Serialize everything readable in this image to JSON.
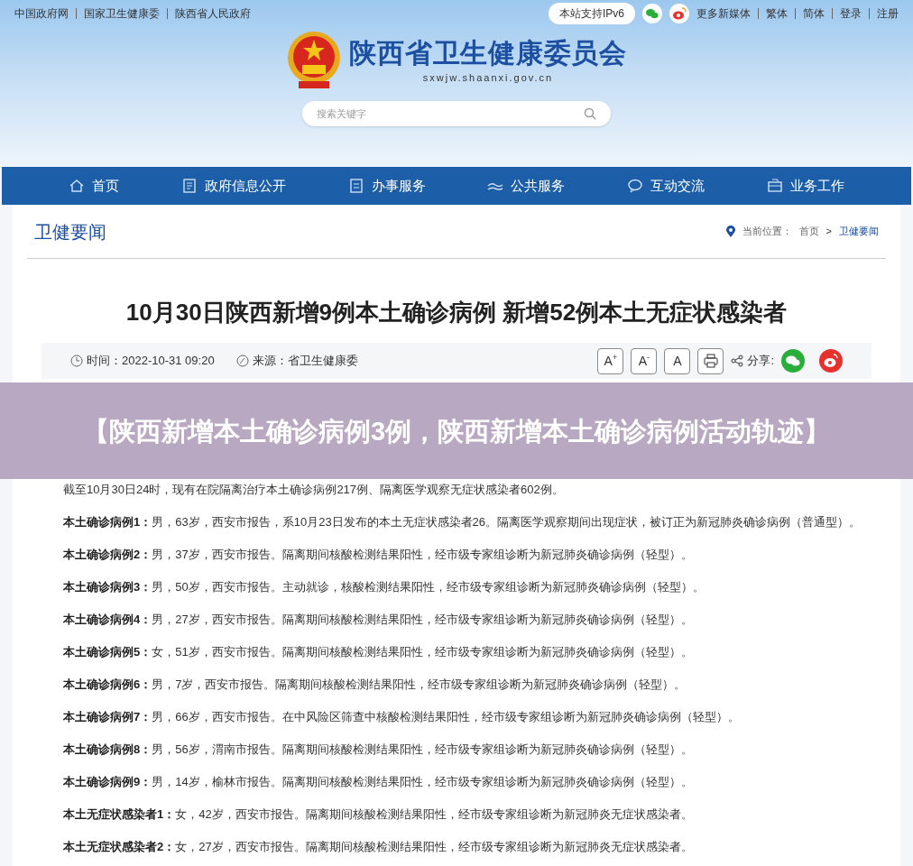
{
  "top_links": [
    "中国政府网",
    "国家卫生健康委",
    "陕西省人民政府"
  ],
  "top_right": {
    "ipv6": "本站支持IPv6",
    "media": "更多新媒体",
    "links": [
      "繁体",
      "简体",
      "登录",
      "注册"
    ]
  },
  "site": {
    "title": "陕西省卫生健康委员会",
    "domain": "sxwjw.shaanxi.gov.cn"
  },
  "search": {
    "placeholder": "搜索关键字"
  },
  "nav": [
    {
      "label": "首页",
      "kind": "home"
    },
    {
      "label": "政府信息公开",
      "kind": "doc"
    },
    {
      "label": "办事服务",
      "kind": "list"
    },
    {
      "label": "公共服务",
      "kind": "hands"
    },
    {
      "label": "互动交流",
      "kind": "chat"
    },
    {
      "label": "业务工作",
      "kind": "work"
    }
  ],
  "section": {
    "title": "卫健要闻",
    "location_label": "当前位置：",
    "breadcrumb": [
      "首页",
      "卫健要闻"
    ],
    "separator": ">"
  },
  "article": {
    "title": "10月30日陕西新增9例本土确诊病例 新增52例本土无症状感染者",
    "time": "时间：2022-10-31 09:20",
    "source": "来源：省卫生健康委",
    "font_buttons": [
      {
        "label": "A",
        "sup": "+"
      },
      {
        "label": "A",
        "sup": "-"
      },
      {
        "label": "A"
      }
    ],
    "share_label": "分享:"
  },
  "banner": "【陕西新增本土确诊病例3例，陕西新增本土确诊病例活动轨迹】",
  "paragraphs": [
    {
      "text": "截至10月30日24时，现有在院隔离治疗本土确诊病例217例、隔离医学观察无症状感染者602例。"
    },
    {
      "lead": "本土确诊病例1：",
      "text": "男，63岁，西安市报告，系10月23日发布的本土无症状感染者26。隔离医学观察期间出现症状，被订正为新冠肺炎确诊病例（普通型）。"
    },
    {
      "lead": "本土确诊病例2：",
      "text": "男，37岁，西安市报告。隔离期间核酸检测结果阳性，经市级专家组诊断为新冠肺炎确诊病例（轻型）。"
    },
    {
      "lead": "本土确诊病例3：",
      "text": "男，50岁，西安市报告。主动就诊，核酸检测结果阳性，经市级专家组诊断为新冠肺炎确诊病例（轻型）。"
    },
    {
      "lead": "本土确诊病例4：",
      "text": "男，27岁，西安市报告。隔离期间核酸检测结果阳性，经市级专家组诊断为新冠肺炎确诊病例（轻型）。"
    },
    {
      "lead": "本土确诊病例5：",
      "text": "女，51岁，西安市报告。隔离期间核酸检测结果阳性，经市级专家组诊断为新冠肺炎确诊病例（轻型）。"
    },
    {
      "lead": "本土确诊病例6：",
      "text": "男，7岁，西安市报告。隔离期间核酸检测结果阳性，经市级专家组诊断为新冠肺炎确诊病例（轻型）。"
    },
    {
      "lead": "本土确诊病例7：",
      "text": "男，66岁，西安市报告。在中风险区筛查中核酸检测结果阳性，经市级专家组诊断为新冠肺炎确诊病例（轻型）。"
    },
    {
      "lead": "本土确诊病例8：",
      "text": "男，56岁，渭南市报告。隔离期间核酸检测结果阳性，经市级专家组诊断为新冠肺炎确诊病例（轻型）。"
    },
    {
      "lead": "本土确诊病例9：",
      "text": "男，14岁，榆林市报告。隔离期间核酸检测结果阳性，经市级专家组诊断为新冠肺炎确诊病例（轻型）。"
    },
    {
      "lead": "本土无症状感染者1：",
      "text": "女，42岁，西安市报告。隔离期间核酸检测结果阳性，经市级专家组诊断为新冠肺炎无症状感染者。"
    },
    {
      "lead": "本土无症状感染者2：",
      "text": "女，27岁，西安市报告。隔离期间核酸检测结果阳性，经市级专家组诊断为新冠肺炎无症状感染者。"
    }
  ]
}
